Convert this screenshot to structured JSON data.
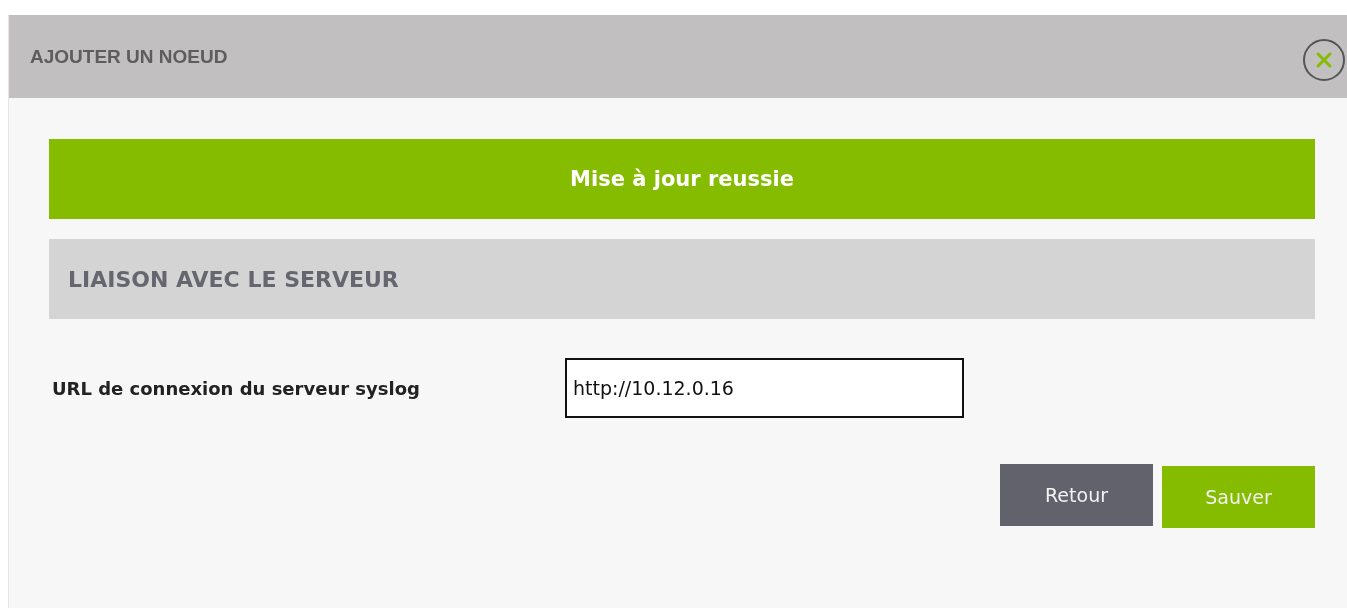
{
  "dialog": {
    "title": "AJOUTER UN NOEUD"
  },
  "alert": {
    "kind": "success",
    "message": "Mise à jour reussie"
  },
  "section": {
    "title": "LIAISON AVEC LE SERVEUR"
  },
  "field": {
    "label": "URL de connexion du serveur syslog",
    "value": "http://10.12.0.16"
  },
  "buttons": [
    {
      "label": "Retour",
      "kind": "secondary"
    },
    {
      "label": "Sauver",
      "kind": "primary"
    }
  ]
}
